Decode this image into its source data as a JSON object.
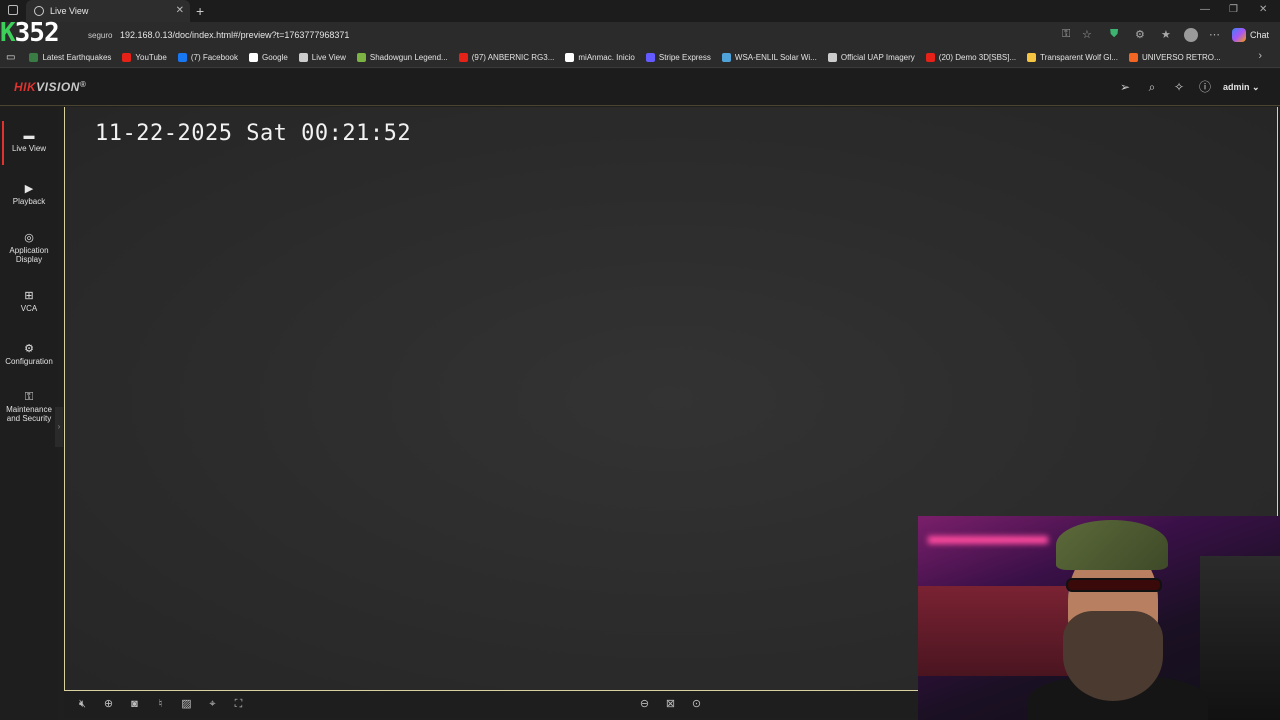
{
  "browser": {
    "tab_title": "Live View",
    "stream_counter_prefix": "K",
    "stream_counter": "352",
    "security_label": "seguro",
    "url": "192.168.0.13/doc/index.html#/preview?t=1763777968371",
    "chat_label": "Chat",
    "bookmarks": [
      {
        "label": "Latest Earthquakes",
        "color": "#3a7d44"
      },
      {
        "label": "YouTube",
        "color": "#e62117"
      },
      {
        "label": "(7) Facebook",
        "color": "#1877f2"
      },
      {
        "label": "Google",
        "color": "#ffffff"
      },
      {
        "label": "Live View",
        "color": "#cccccc"
      },
      {
        "label": "Shadowgun Legend...",
        "color": "#7cb342"
      },
      {
        "label": "(97) ANBERNIC RG3...",
        "color": "#e62117"
      },
      {
        "label": "miAnmac. Inicio",
        "color": "#ffffff"
      },
      {
        "label": "Stripe Express",
        "color": "#635bff"
      },
      {
        "label": "WSA-ENLIL Solar Wi...",
        "color": "#4fa3d9"
      },
      {
        "label": "Official UAP Imagery",
        "color": "#cccccc"
      },
      {
        "label": "(20) Demo 3D[SBS]...",
        "color": "#e62117"
      },
      {
        "label": "Transparent Wolf Gl...",
        "color": "#f5c542"
      },
      {
        "label": "UNIVERSO RETRO...",
        "color": "#f26522"
      }
    ]
  },
  "app": {
    "logo_part1": "HIK",
    "logo_part2": "VISION",
    "logo_mark": "®",
    "brand_color": "#e0322e",
    "user": "admin",
    "nav": [
      {
        "label": "Live View",
        "icon": "live-view-icon",
        "active": true
      },
      {
        "label": "Playback",
        "icon": "playback-icon"
      },
      {
        "label": "Application Display",
        "icon": "application-display-icon"
      },
      {
        "label": "VCA",
        "icon": "vca-icon"
      },
      {
        "label": "Configuration",
        "icon": "configuration-icon"
      },
      {
        "label": "Maintenance and Security",
        "icon": "maintenance-icon"
      }
    ],
    "osd_timestamp": "11-22-2025 Sat 00:21:52"
  }
}
